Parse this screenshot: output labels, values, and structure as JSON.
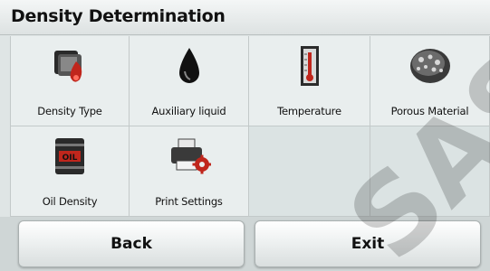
{
  "title": "Density Determination",
  "tiles": [
    {
      "label": "Density Type",
      "icon": "density-type-icon"
    },
    {
      "label": "Auxiliary liquid",
      "icon": "liquid-drop-icon"
    },
    {
      "label": "Temperature",
      "icon": "thermometer-icon"
    },
    {
      "label": "Porous Material",
      "icon": "porous-stone-icon"
    },
    {
      "label": "Oil Density",
      "icon": "oil-barrel-icon"
    },
    {
      "label": "Print Settings",
      "icon": "printer-settings-icon"
    }
  ],
  "oil_badge": "OIL",
  "buttons": {
    "back": "Back",
    "exit": "Exit"
  },
  "watermark": "SAS",
  "colors": {
    "accent_red": "#c0261c",
    "title_bar": "#e8ecec",
    "tile": "#e9eeee"
  }
}
